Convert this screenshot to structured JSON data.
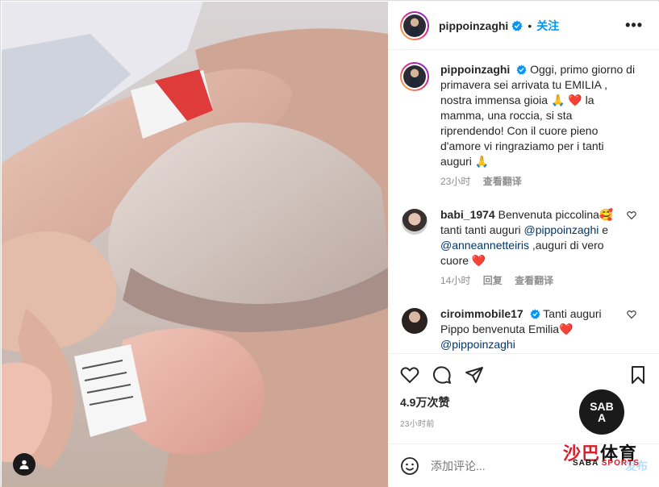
{
  "post": {
    "username": "pippoinzaghi",
    "separator": "•",
    "follow_label": "关注",
    "more_label": "•••"
  },
  "caption": {
    "username": "pippoinzaghi",
    "text": "Oggi, primo giorno di primavera sei arrivata tu EMILIA , nostra immensa gioia 🙏 ❤️ la mamma, una roccia, si sta riprendendo! Con il cuore pieno d'amore vi ringraziamo per i tanti auguri 🙏",
    "time": "23小时",
    "translate": "查看翻译"
  },
  "comments": [
    {
      "username": "babi_1974",
      "text_before": "Benvenuta piccolina🥰 tanti tanti auguri ",
      "mention1": "@pippoinzaghi",
      "text_mid": " e ",
      "mention2": "@anneannetteiris",
      "text_after": " ,auguri di vero cuore ❤️",
      "time": "14小时",
      "reply": "回复",
      "translate": "查看翻译"
    },
    {
      "username": "ciroimmobile17",
      "text_before": "Tanti auguri Pippo benvenuta Emilia❤️ ",
      "mention1": "@pippoinzaghi"
    }
  ],
  "engagement": {
    "likes": "4.9万次赞",
    "time": "23小时前"
  },
  "composer": {
    "placeholder": "添加评论...",
    "post_label": "发布"
  },
  "watermark": {
    "logo_text": "SABA",
    "cn_red": "沙巴",
    "cn_black": "体育",
    "en_black": "SABA ",
    "en_red": "SPORTS"
  },
  "colors": {
    "accent": "#0095f6",
    "heart": "#ed4956",
    "mention": "#00376b",
    "secondary_text": "#8e8e8e"
  }
}
